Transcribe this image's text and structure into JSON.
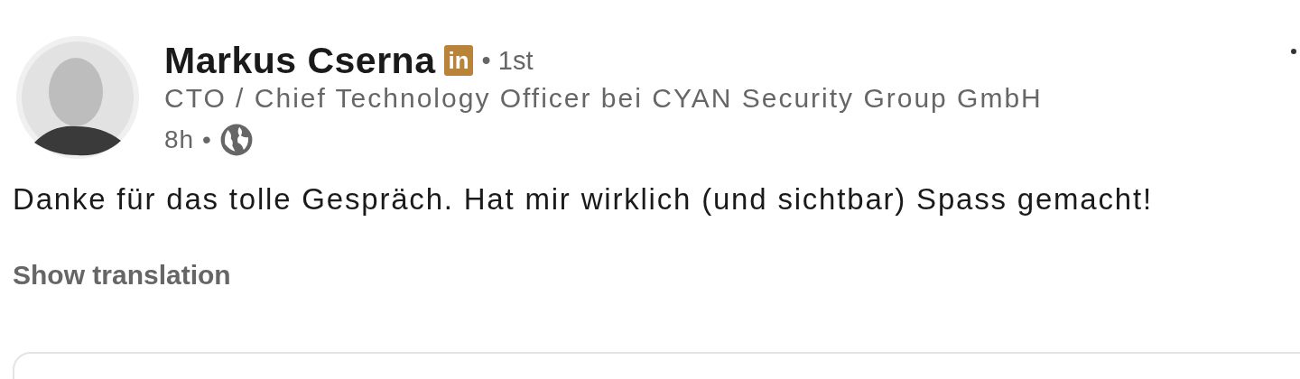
{
  "author": {
    "name": "Markus Cserna",
    "badge": "in",
    "degree": "• 1st",
    "headline": "CTO / Chief Technology Officer bei CYAN Security Group GmbH",
    "time": "8h •",
    "public": true
  },
  "body": "Danke für das tolle Gespräch. Hat mir wirklich (und sichtbar) Spass gemacht!",
  "translation_link": "Show translation"
}
